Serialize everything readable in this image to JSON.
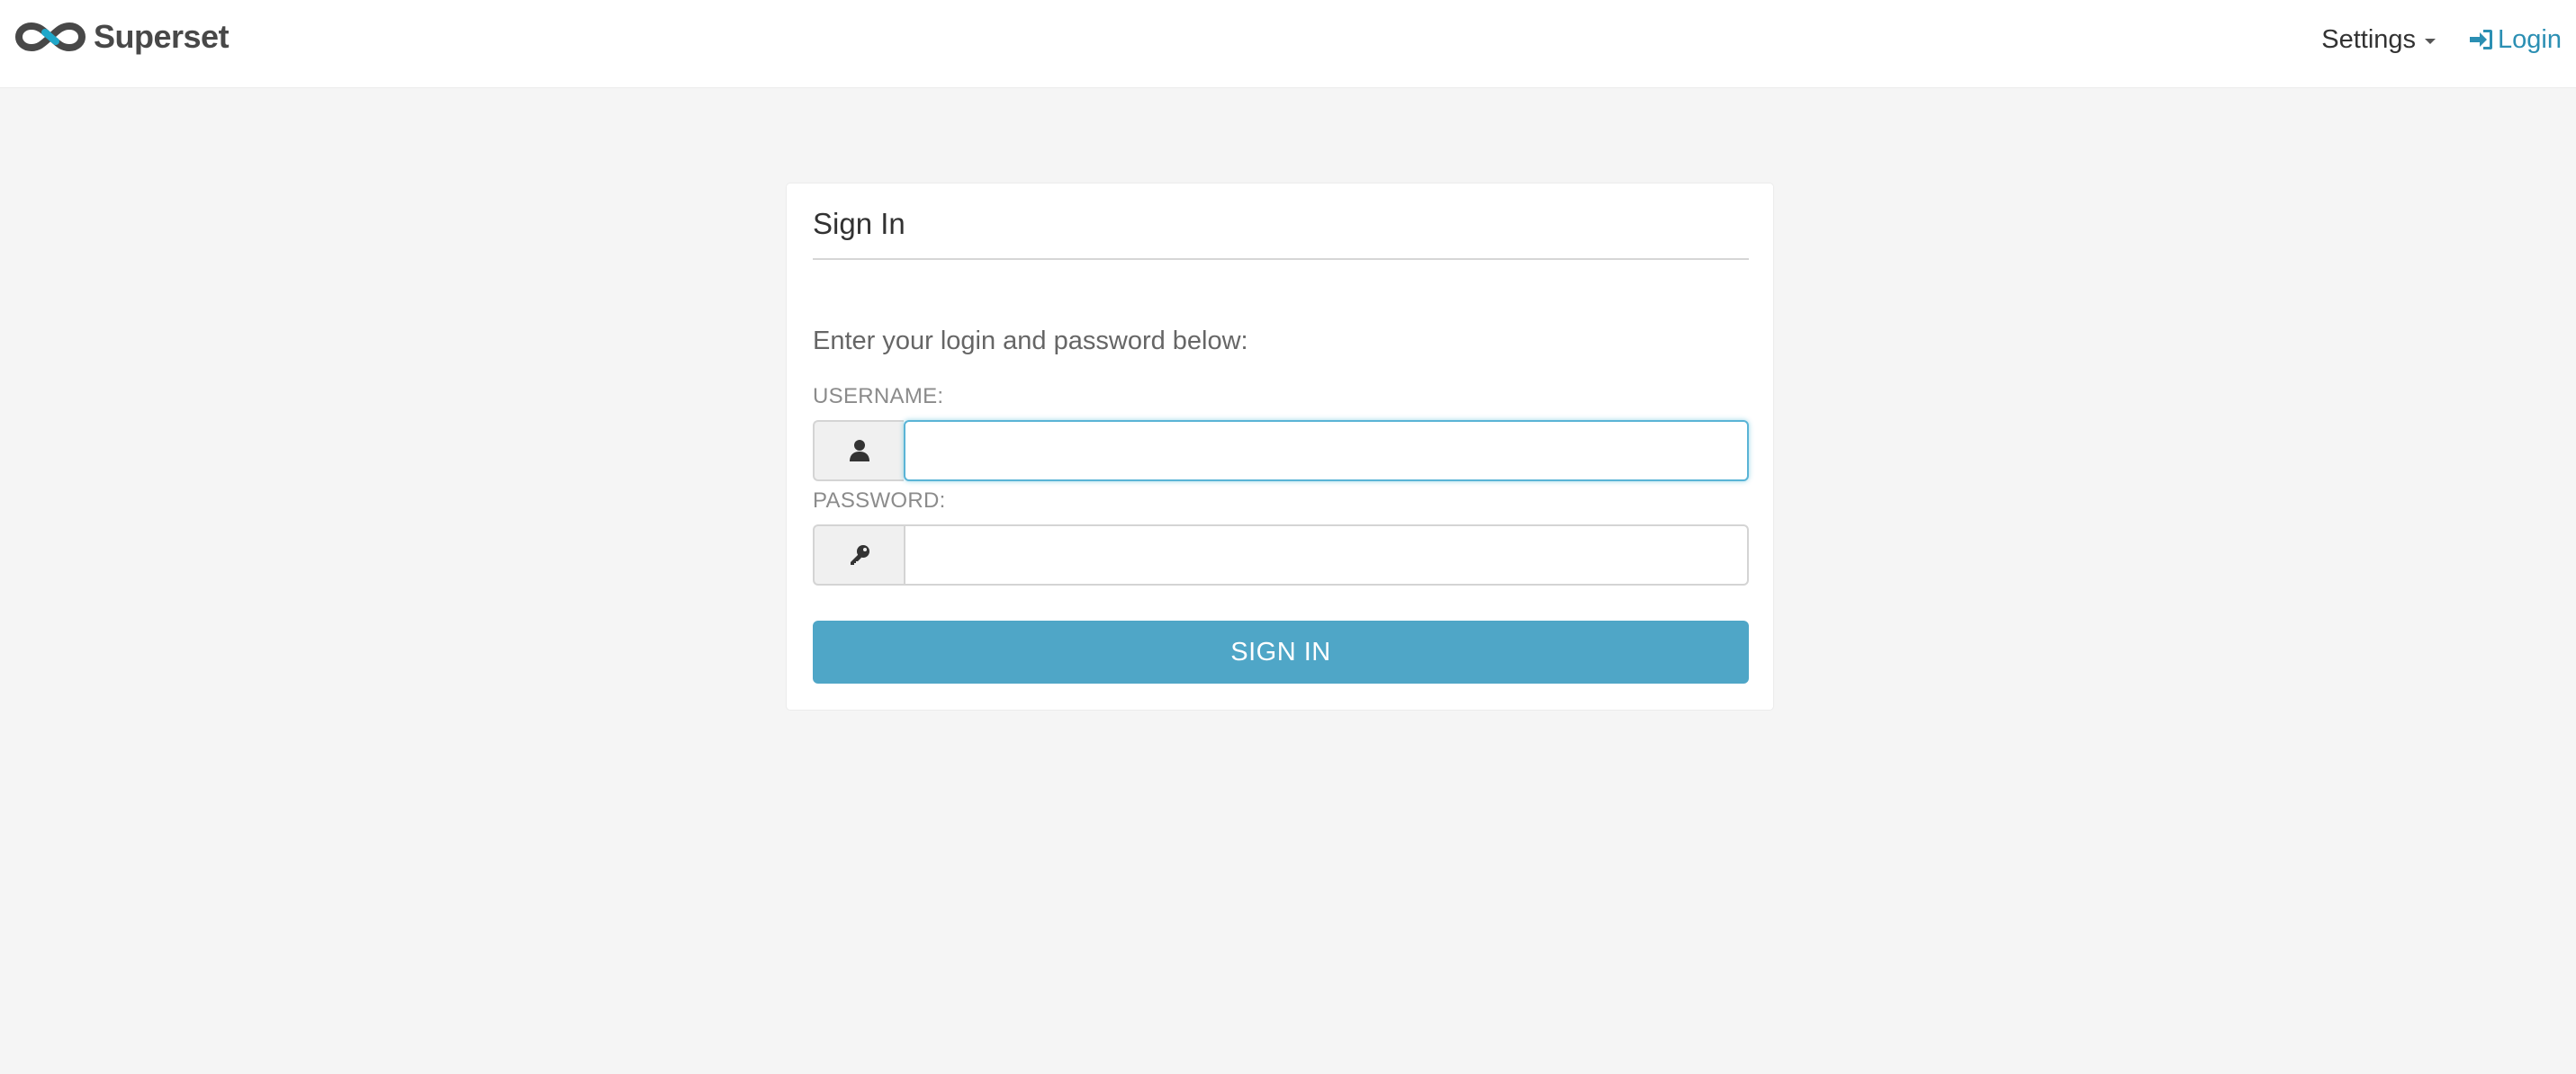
{
  "brand": {
    "name": "Superset",
    "logo_icon": "superset-infinity-logo"
  },
  "nav": {
    "settings_label": "Settings",
    "settings_icon": "caret-down-icon",
    "login_label": "Login",
    "login_icon": "sign-in-icon"
  },
  "signin_form": {
    "title": "Sign In",
    "instructions": "Enter your login and password below:",
    "username_label": "USERNAME:",
    "username_icon": "user-icon",
    "username_value": "",
    "password_label": "PASSWORD:",
    "password_icon": "key-icon",
    "password_value": "",
    "submit_label": "SIGN IN"
  },
  "colors": {
    "accent": "#4fa6c7",
    "link": "#2b8fb3",
    "page_background": "#f5f5f5",
    "focus_ring": "#5ab4d6"
  }
}
